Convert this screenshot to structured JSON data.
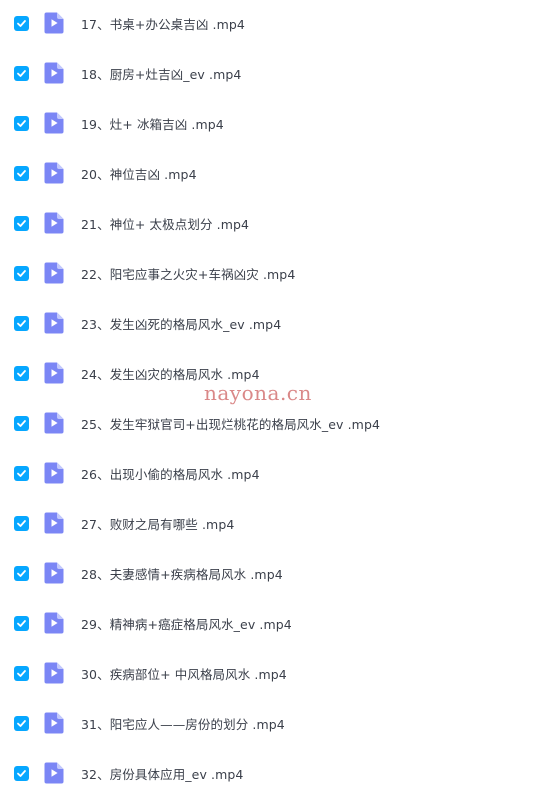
{
  "files": [
    {
      "name": "17、书桌+办公桌吉凶 .mp4",
      "checked": true
    },
    {
      "name": "18、厨房+灶吉凶_ev .mp4",
      "checked": true
    },
    {
      "name": "19、灶+ 冰箱吉凶 .mp4",
      "checked": true
    },
    {
      "name": "20、神位吉凶 .mp4",
      "checked": true
    },
    {
      "name": "21、神位+ 太极点划分 .mp4",
      "checked": true
    },
    {
      "name": "22、阳宅应事之火灾+车祸凶灾 .mp4",
      "checked": true
    },
    {
      "name": "23、发生凶死的格局风水_ev .mp4",
      "checked": true
    },
    {
      "name": "24、发生凶灾的格局风水 .mp4",
      "checked": true
    },
    {
      "name": "25、发生牢狱官司+出现烂桃花的格局风水_ev .mp4",
      "checked": true
    },
    {
      "name": "26、出现小偷的格局风水 .mp4",
      "checked": true
    },
    {
      "name": "27、败财之局有哪些 .mp4",
      "checked": true
    },
    {
      "name": "28、夫妻感情+疾病格局风水 .mp4",
      "checked": true
    },
    {
      "name": "29、精神病+癌症格局风水_ev .mp4",
      "checked": true
    },
    {
      "name": "30、疾病部位+ 中风格局风水 .mp4",
      "checked": true
    },
    {
      "name": "31、阳宅应人——房份的划分 .mp4",
      "checked": true
    },
    {
      "name": "32、房份具体应用_ev .mp4",
      "checked": true
    }
  ],
  "watermark": "nayona.cn",
  "colors": {
    "checkbox": "#06a7ff",
    "file_icon": "#7b86f5",
    "file_icon_fold": "#c3c9fb",
    "text": "#3a3f4a",
    "watermark": "#d67c7c"
  },
  "icons": {
    "checkbox": "checkmark-icon",
    "file": "video-file-icon"
  }
}
